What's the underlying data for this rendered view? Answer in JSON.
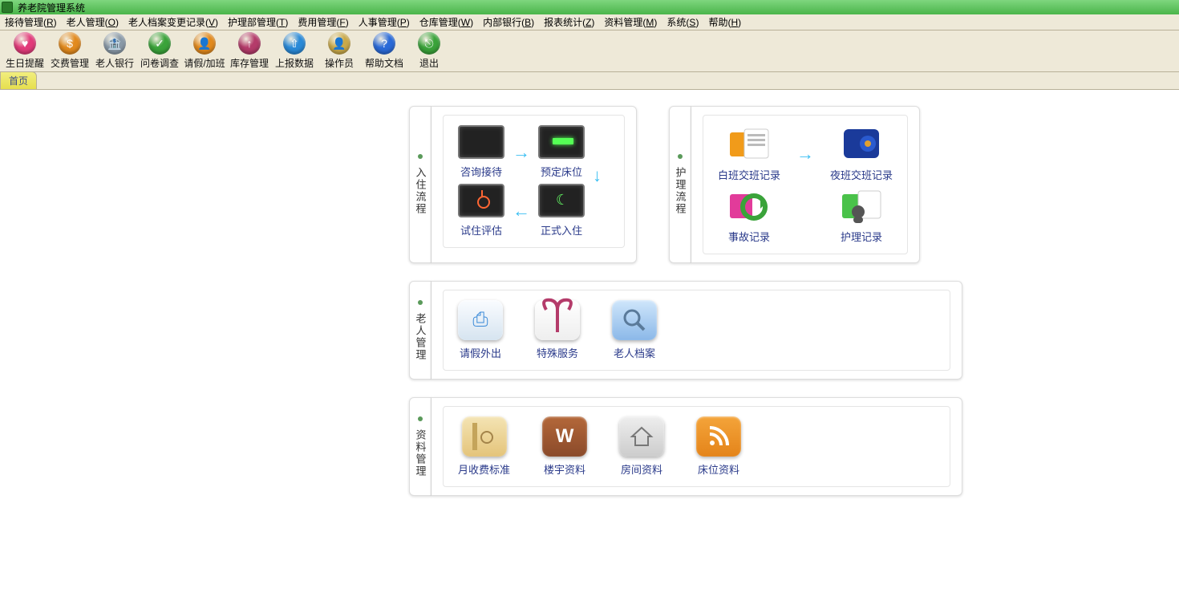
{
  "app": {
    "title": "养老院管理系统"
  },
  "menu": [
    {
      "label": "接待管理",
      "key": "R"
    },
    {
      "label": "老人管理",
      "key": "O"
    },
    {
      "label": "老人档案变更记录",
      "key": "V"
    },
    {
      "label": "护理部管理",
      "key": "T"
    },
    {
      "label": "费用管理",
      "key": "F"
    },
    {
      "label": "人事管理",
      "key": "P"
    },
    {
      "label": "仓库管理",
      "key": "W"
    },
    {
      "label": "内部银行",
      "key": "B"
    },
    {
      "label": "报表统计",
      "key": "Z"
    },
    {
      "label": "资料管理",
      "key": "M"
    },
    {
      "label": "系统",
      "key": "S"
    },
    {
      "label": "帮助",
      "key": "H"
    }
  ],
  "toolbar": [
    {
      "label": "生日提醒",
      "color": "#e23b7a",
      "glyph": "♥"
    },
    {
      "label": "交费管理",
      "color": "#e28a1e",
      "glyph": "$"
    },
    {
      "label": "老人银行",
      "color": "#8a9aa8",
      "glyph": "🏦"
    },
    {
      "label": "问卷调查",
      "color": "#3aa33a",
      "glyph": "✓"
    },
    {
      "label": "请假/加班",
      "color": "#e28a1e",
      "glyph": "👤"
    },
    {
      "label": "库存管理",
      "color": "#b43b6a",
      "glyph": "↑"
    },
    {
      "label": "上报数据",
      "color": "#2a8ad8",
      "glyph": "⇧"
    },
    {
      "label": "操作员",
      "color": "#c9a94a",
      "glyph": "👤"
    },
    {
      "label": "帮助文档",
      "color": "#2a6ad8",
      "glyph": "?"
    },
    {
      "label": "退出",
      "color": "#3aa33a",
      "glyph": "⎋"
    }
  ],
  "tabs": {
    "active": "首页"
  },
  "panels": {
    "checkin": {
      "title": "入住流程",
      "items": {
        "consult": "咨询接待",
        "reserve": "预定床位",
        "trial": "试住评估",
        "formal": "正式入住"
      }
    },
    "care": {
      "title": "护理流程",
      "items": {
        "dayshift": "白班交班记录",
        "nightshift": "夜班交班记录",
        "accident": "事故记录",
        "nursing": "护理记录"
      }
    },
    "elder": {
      "title": "老人管理",
      "items": {
        "leave": "请假外出",
        "special": "特殊服务",
        "archive": "老人档案"
      }
    },
    "data": {
      "title": "资料管理",
      "items": {
        "fee": "月收费标准",
        "building": "楼宇资料",
        "room": "房间资料",
        "bed": "床位资料"
      }
    }
  }
}
